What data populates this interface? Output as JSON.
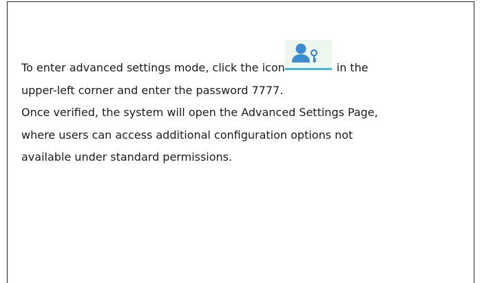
{
  "doc": {
    "line1_before": "To enter advanced settings mode, click the icon",
    "line1_after": "in the",
    "line2": "upper-left corner and enter the password 7777.",
    "line3": "Once verified, the system will open the Advanced Settings Page,",
    "line4": "where users can access additional configuration options not",
    "line5": "available under standard permissions.",
    "icon": "user-key-icon"
  },
  "colors": {
    "icon_blue": "#3d8bd1",
    "icon_bg": "#eef7ee",
    "icon_underline": "#48b3e6",
    "text": "#1a1a1a",
    "border": "#222222"
  }
}
